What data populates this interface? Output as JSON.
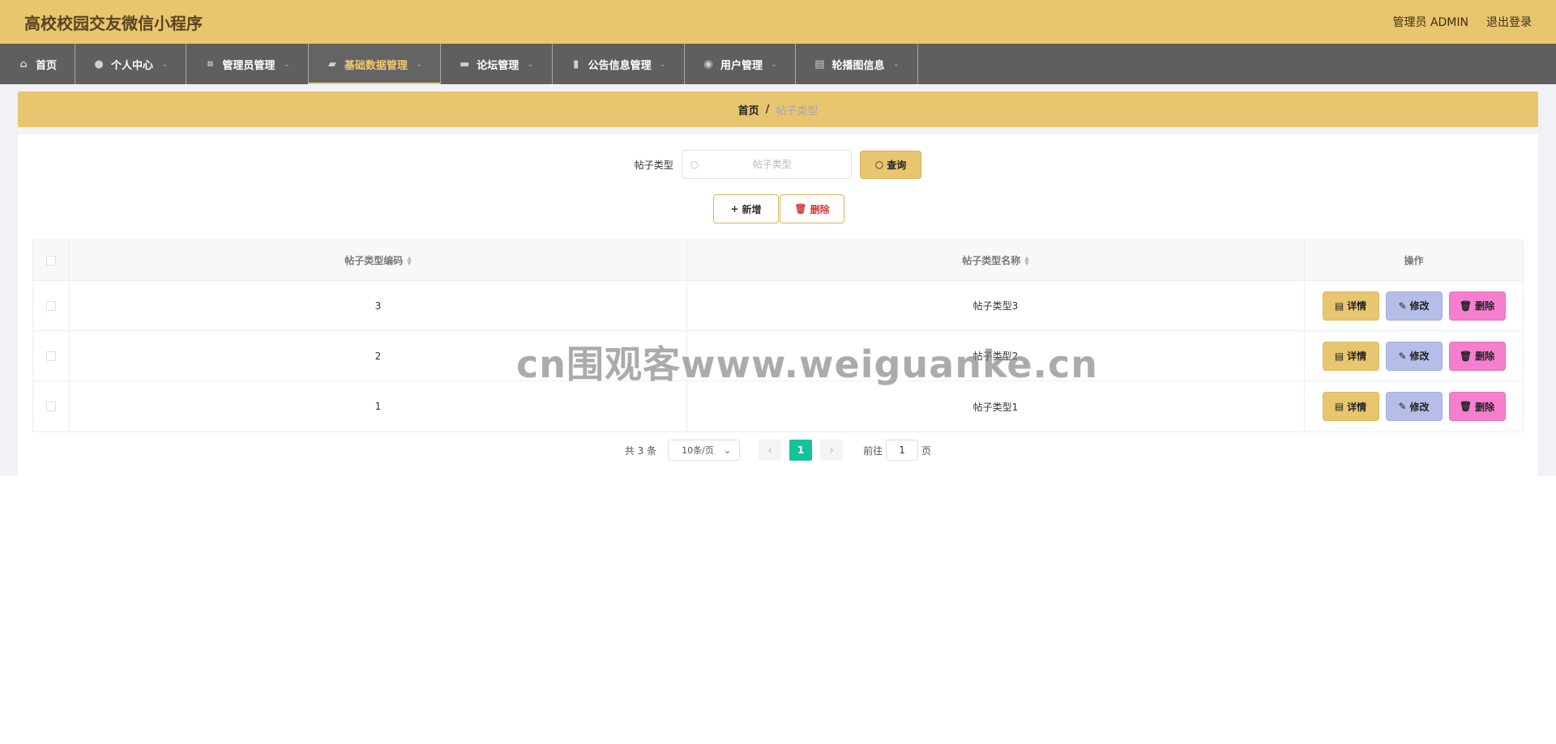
{
  "app": {
    "title": "高校校园交友微信小程序"
  },
  "header": {
    "admin_label": "管理员 ADMIN",
    "logout_label": "退出登录"
  },
  "nav": {
    "items": [
      {
        "label": "首页",
        "icon": "home-icon"
      },
      {
        "label": "个人中心",
        "icon": "user-icon"
      },
      {
        "label": "管理员管理",
        "icon": "crop-icon"
      },
      {
        "label": "基础数据管理",
        "icon": "data-icon",
        "active": true
      },
      {
        "label": "论坛管理",
        "icon": "briefcase-icon"
      },
      {
        "label": "公告信息管理",
        "icon": "bar-chart-icon"
      },
      {
        "label": "用户管理",
        "icon": "location-icon"
      },
      {
        "label": "轮播图信息",
        "icon": "document-icon"
      }
    ]
  },
  "breadcrumb": {
    "home": "首页",
    "separator": "/",
    "current": "帖子类型"
  },
  "search": {
    "label": "帖子类型",
    "placeholder": "帖子类型",
    "value": "",
    "button_label": "查询"
  },
  "actions": {
    "add_label": "新增",
    "delete_label": "删除"
  },
  "table": {
    "columns": {
      "code": "帖子类型编码",
      "name": "帖子类型名称",
      "ops": "操作"
    },
    "rows": [
      {
        "code": "3",
        "name": "帖子类型3"
      },
      {
        "code": "2",
        "name": "帖子类型2"
      },
      {
        "code": "1",
        "name": "帖子类型1"
      }
    ],
    "row_actions": {
      "detail": "详情",
      "edit": "修改",
      "delete": "删除"
    }
  },
  "pagination": {
    "total_text": "共 3 条",
    "page_size": "10条/页",
    "current_page": "1",
    "goto_prefix": "前往",
    "goto_value": "1",
    "goto_suffix": "页"
  },
  "watermark": "cn围观客www.weiguanke.cn",
  "colors": {
    "header": "#e8c56f",
    "nav": "#5f5f5f",
    "nav_active": "#f2c96c",
    "detail": "#e8c56f",
    "edit": "#b5bde8",
    "delete": "#f57fce",
    "page_active": "#13c39a"
  }
}
